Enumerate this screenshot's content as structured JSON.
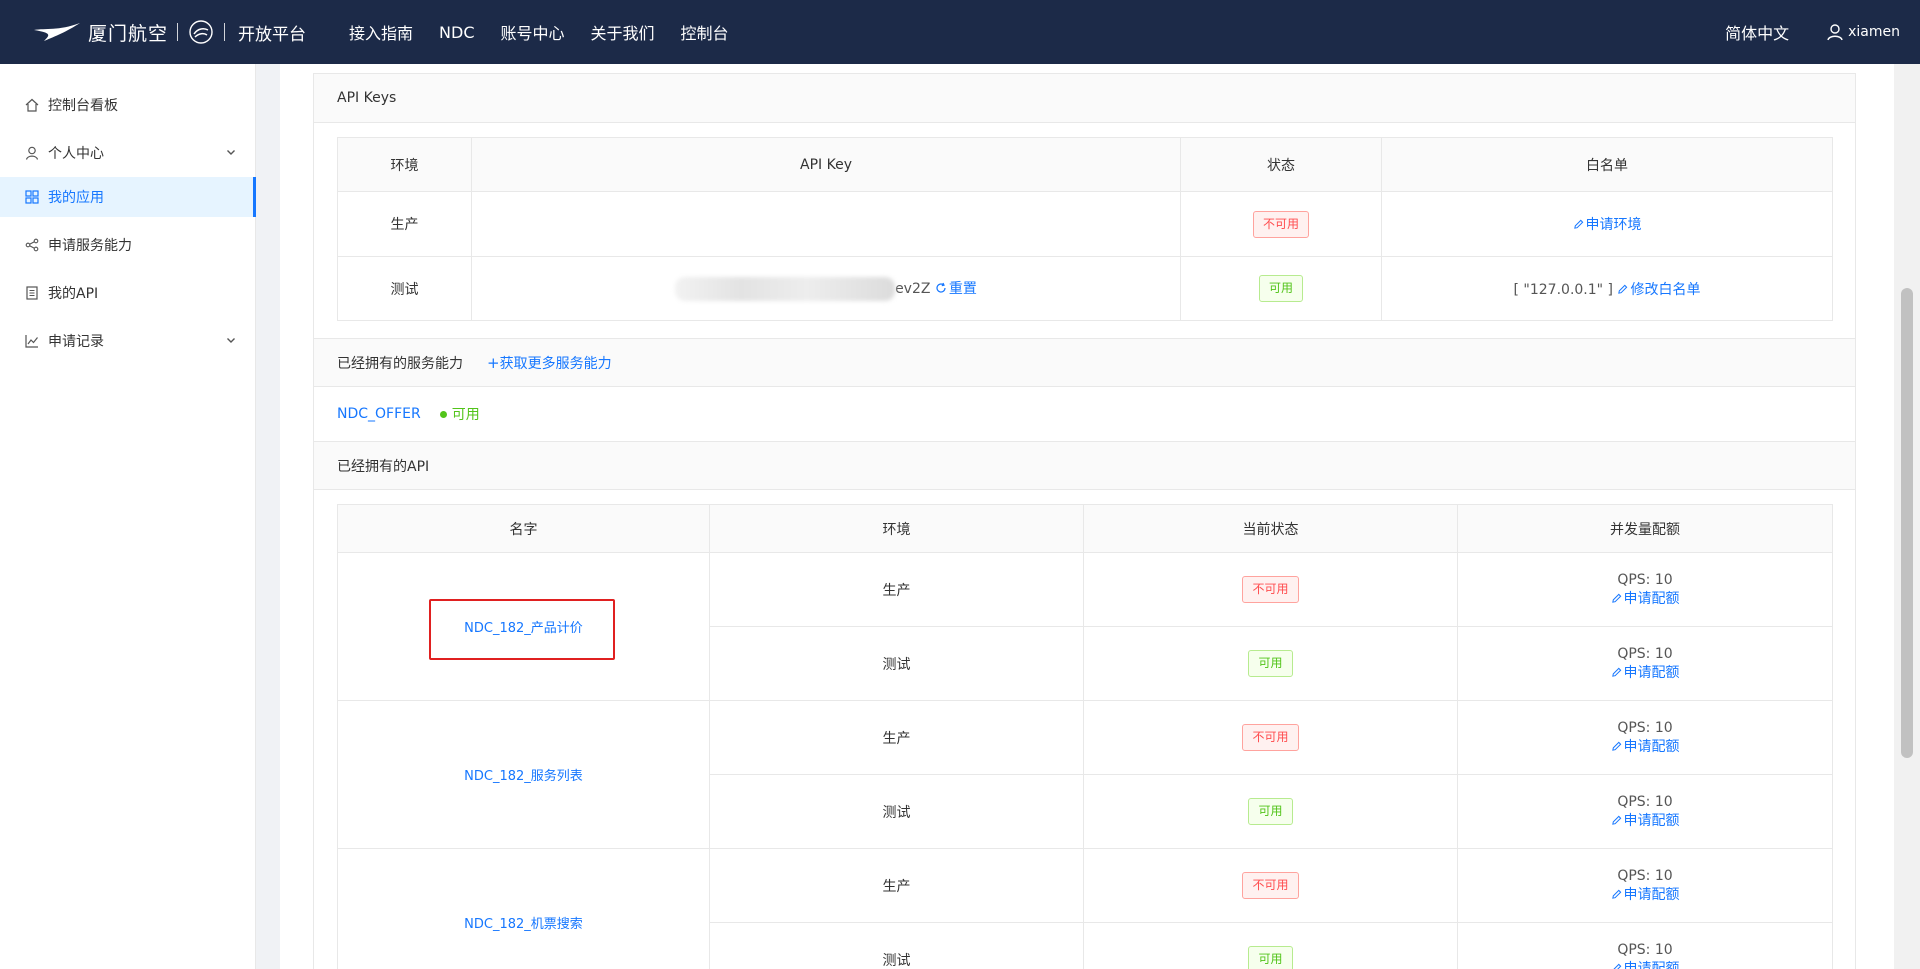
{
  "header": {
    "brand": "厦门航空",
    "platform": "开放平台",
    "nav": [
      "接入指南",
      "NDC",
      "账号中心",
      "关于我们",
      "控制台"
    ],
    "language": "简体中文",
    "username": "xiamen"
  },
  "sidebar": {
    "items": [
      {
        "label": "控制台看板",
        "icon": "home-icon"
      },
      {
        "label": "个人中心",
        "icon": "user-icon",
        "expandable": true
      },
      {
        "label": "我的应用",
        "icon": "app-grid-icon",
        "active": true
      },
      {
        "label": "申请服务能力",
        "icon": "share-icon"
      },
      {
        "label": "我的API",
        "icon": "document-icon"
      },
      {
        "label": "申请记录",
        "icon": "line-chart-icon",
        "expandable": true
      }
    ]
  },
  "api_keys": {
    "title": "API Keys",
    "columns": [
      "环境",
      "API Key",
      "状态",
      "白名单"
    ],
    "rows": [
      {
        "env": "生产",
        "key_suffix": "",
        "status": "不可用",
        "status_type": "unavailable",
        "whitelist_action": "申请环境",
        "whitelist_value": ""
      },
      {
        "env": "测试",
        "key_suffix": "ev2Z",
        "reset_label": "重置",
        "status": "可用",
        "status_type": "available",
        "whitelist_value": "[ \"127.0.0.1\" ]",
        "whitelist_action": "修改白名单"
      }
    ]
  },
  "services": {
    "title": "已经拥有的服务能力",
    "more_link": "获取更多服务能力",
    "items": [
      {
        "name": "NDC_OFFER",
        "status": "可用"
      }
    ]
  },
  "apis": {
    "title": "已经拥有的API",
    "columns": [
      "名字",
      "环境",
      "当前状态",
      "并发量配额"
    ],
    "groups": [
      {
        "name": "NDC_182_产品计价",
        "highlighted": true,
        "rows": [
          {
            "env": "生产",
            "status": "不可用",
            "quota": "QPS: 10",
            "action": "申请配额"
          },
          {
            "env": "测试",
            "status": "可用",
            "quota": "QPS: 10",
            "action": "申请配额"
          }
        ]
      },
      {
        "name": "NDC_182_服务列表",
        "rows": [
          {
            "env": "生产",
            "status": "不可用",
            "quota": "QPS: 10",
            "action": "申请配额"
          },
          {
            "env": "测试",
            "status": "可用",
            "quota": "QPS: 10",
            "action": "申请配额"
          }
        ]
      },
      {
        "name": "NDC_182_机票搜索",
        "rows": [
          {
            "env": "生产",
            "status": "不可用",
            "quota": "QPS: 10",
            "action": "申请配额"
          },
          {
            "env": "测试",
            "status": "可用",
            "quota": "QPS: 10",
            "action": "申请配额"
          }
        ]
      }
    ]
  },
  "colors": {
    "header_bg": "#1c2a48",
    "primary": "#1677ff",
    "unavailable": "#ff4d4f",
    "available": "#52c41a",
    "highlight_box": "#e02020"
  }
}
